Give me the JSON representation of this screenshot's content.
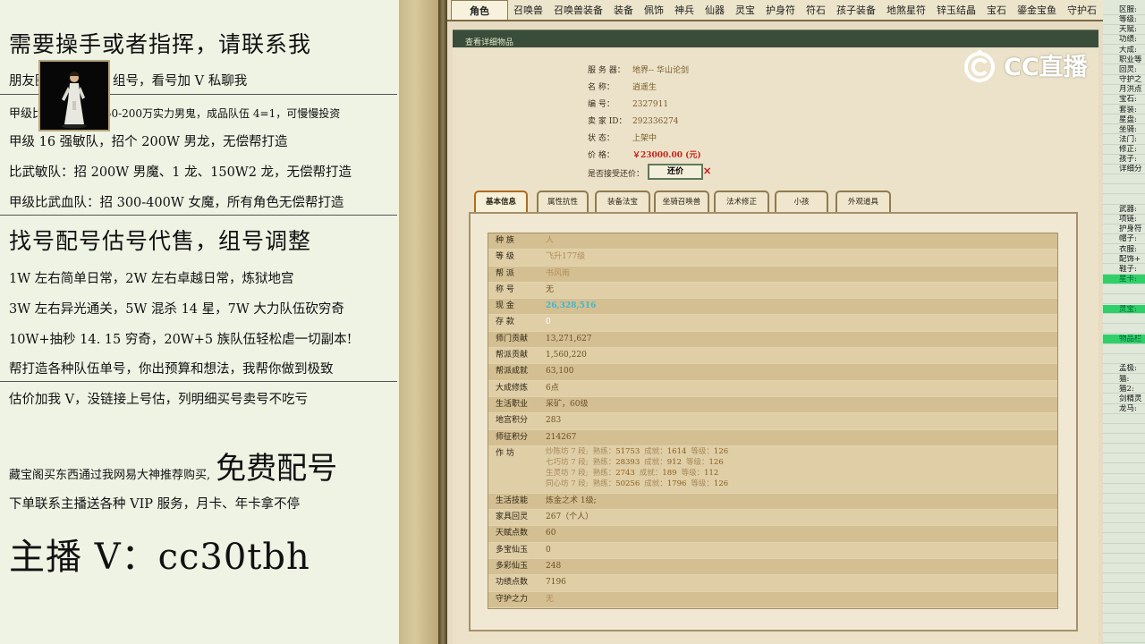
{
  "promo": {
    "line1": "需要操手或者指挥，请联系我",
    "line2": "朋友圈各种单号，组号，看号加 V 私聊我",
    "line3a": "甲级比武血队：",
    "line3b": "招 50-200万实力男鬼，成品队伍 4=1，可慢慢投资",
    "line4": "甲级 16 强敏队，招个 200W 男龙，无偿帮打造",
    "line5": "比武敏队：招 200W 男魔、1 龙、150W2 龙，无偿帮打造",
    "line6": "甲级比武血队：招 300-400W 女魔，所有角色无偿帮打造",
    "line7": "找号配号估号代售，组号调整",
    "line8": "1W 左右简单日常，2W 左右卓越日常，炼狱地宫",
    "line9": "3W 左右异光通关，5W 混杀 14 星，7W 大力队伍砍穷奇",
    "line10": "10W+抽秒 14. 15 穷奇，20W+5 族队伍轻松虐一切副本!",
    "line11": "帮打造各种队伍单号，你出预算和想法，我帮你做到极致",
    "line12": "估价加我 V，没链接上号估，列明细买号卖号不吃亏",
    "line13a": "藏宝阁买东西通过我网易大神推荐购买,",
    "line13b": "免费配号",
    "line14": "下单联系主播送各种 VIP 服务，月卡、年卡拿不停",
    "line15": "主播 V：cc30tbh"
  },
  "nav": {
    "tabs": [
      "角色",
      "召唤兽",
      "召唤兽装备",
      "装备",
      "佩饰",
      "神兵",
      "仙器",
      "灵宝",
      "护身符",
      "符石",
      "孩子装备",
      "地煞星符",
      "锌玉结晶",
      "宝石",
      "鎏金宝鱼",
      "守护石"
    ]
  },
  "page_title": "查看详细物品",
  "item": {
    "server_label": "服 务 器：",
    "server": "地界-- 华山论剑",
    "name_label": "名        称：",
    "name": "逍遥生",
    "id_label": "编        号：",
    "id": "2327911",
    "seller_label": "卖   家   ID：",
    "seller": "292336274",
    "status_label": "状        态：",
    "status": "上架中",
    "price_label": "价        格：",
    "price": "￥23000.00 (元)",
    "offer_label": "是否接受还价：",
    "offer_button": "还价"
  },
  "subtabs": [
    "基本信息",
    "属性抗性",
    "装备法宝",
    "坐骑召唤兽",
    "法术修正",
    "小孩",
    "外观道具"
  ],
  "attributes": [
    {
      "k": "种        族",
      "v": "人",
      "style": "pale"
    },
    {
      "k": "等        级",
      "v": "飞升177级",
      "style": "pale"
    },
    {
      "k": "帮        派",
      "v": "书风雨",
      "style": "pale"
    },
    {
      "k": "称        号",
      "v": "无",
      "style": ""
    },
    {
      "k": "现        金",
      "v": "26,328,516",
      "style": "cyan"
    },
    {
      "k": "存        款",
      "v": "0",
      "style": "white"
    },
    {
      "k": "师门贡献",
      "v": "13,271,627",
      "style": ""
    },
    {
      "k": "帮派贡献",
      "v": "1,560,220",
      "style": ""
    },
    {
      "k": "帮派成就",
      "v": "63,100",
      "style": ""
    },
    {
      "k": "大成修炼",
      "v": "6点",
      "style": ""
    },
    {
      "k": "生活职业",
      "v": "采矿，60级",
      "style": ""
    },
    {
      "k": "地宫积分",
      "v": "283",
      "style": ""
    },
    {
      "k": "师征积分",
      "v": "214267",
      "style": ""
    }
  ],
  "workshop": {
    "label": "作        坊",
    "lines": [
      {
        "name": "炒陈坊 7 段;",
        "a": "熟练：",
        "av": "51753",
        "b": "成就：",
        "bv": "1614",
        "c": "等级：",
        "cv": "126"
      },
      {
        "name": "七巧坊 7 段;",
        "a": "熟练：",
        "av": "28393",
        "b": "成就：",
        "bv": "912",
        "c": "等级：",
        "cv": "126"
      },
      {
        "name": "生灵坊 7 段;",
        "a": "熟练：",
        "av": "2743",
        "b": "成就：",
        "bv": "189",
        "c": "等级：",
        "cv": "112"
      },
      {
        "name": "同心坊 7 段;",
        "a": "熟练：",
        "av": "50256",
        "b": "成就：",
        "bv": "1796",
        "c": "等级：",
        "cv": "126"
      }
    ]
  },
  "attributes2": [
    {
      "k": "生活技能",
      "v": "炼金之术 1级;",
      "style": ""
    },
    {
      "k": "家具回灵",
      "v": "267（个人）",
      "style": ""
    },
    {
      "k": "天赋点数",
      "v": "60",
      "style": ""
    },
    {
      "k": "多宝仙玉",
      "v": "0",
      "style": ""
    },
    {
      "k": "多彩仙玉",
      "v": "248",
      "style": ""
    },
    {
      "k": "功绩点数",
      "v": "7196",
      "style": ""
    },
    {
      "k": "守护之力",
      "v": "无",
      "style": "pale"
    }
  ],
  "sidecol": [
    {
      "t": "区服:",
      "g": false
    },
    {
      "t": "等级:",
      "g": false
    },
    {
      "t": "天赋:",
      "g": false
    },
    {
      "t": "功绩:",
      "g": false
    },
    {
      "t": "大成:",
      "g": false
    },
    {
      "t": "职业等",
      "g": false
    },
    {
      "t": "回灵:",
      "g": false
    },
    {
      "t": "守护之",
      "g": false
    },
    {
      "t": "月洪点",
      "g": false
    },
    {
      "t": "宝石:",
      "g": false
    },
    {
      "t": "套装:",
      "g": false
    },
    {
      "t": "星盘:",
      "g": false
    },
    {
      "t": "坐骑:",
      "g": false
    },
    {
      "t": "法门:",
      "g": false
    },
    {
      "t": "修正:",
      "g": false
    },
    {
      "t": "孩子:",
      "g": false
    },
    {
      "t": "详细分",
      "g": false
    },
    {
      "t": "",
      "g": false
    },
    {
      "t": "",
      "g": false
    },
    {
      "t": "",
      "g": false
    },
    {
      "t": "武器:",
      "g": false
    },
    {
      "t": "项链:",
      "g": false
    },
    {
      "t": "护身符",
      "g": false
    },
    {
      "t": "帽子:",
      "g": false
    },
    {
      "t": "衣服:",
      "g": false
    },
    {
      "t": "配饰+",
      "g": false
    },
    {
      "t": "鞋子:",
      "g": false
    },
    {
      "t": "星卡:",
      "g": true
    },
    {
      "t": "",
      "g": false
    },
    {
      "t": "",
      "g": false
    },
    {
      "t": "灵宝:",
      "g": true
    },
    {
      "t": "",
      "g": false
    },
    {
      "t": "",
      "g": false
    },
    {
      "t": "物品栏",
      "g": true
    },
    {
      "t": "",
      "g": false
    },
    {
      "t": "",
      "g": false
    },
    {
      "t": "孟极:",
      "g": false
    },
    {
      "t": "猫:",
      "g": false
    },
    {
      "t": "猫2:",
      "g": false
    },
    {
      "t": "剑精灵",
      "g": false
    },
    {
      "t": "龙马:",
      "g": false
    }
  ],
  "watermark": "CC直播",
  "colors": {
    "accent": "#3a4d3a",
    "price": "#c6261c",
    "cash": "#3fb6ce",
    "highlight": "#2fd06a"
  }
}
